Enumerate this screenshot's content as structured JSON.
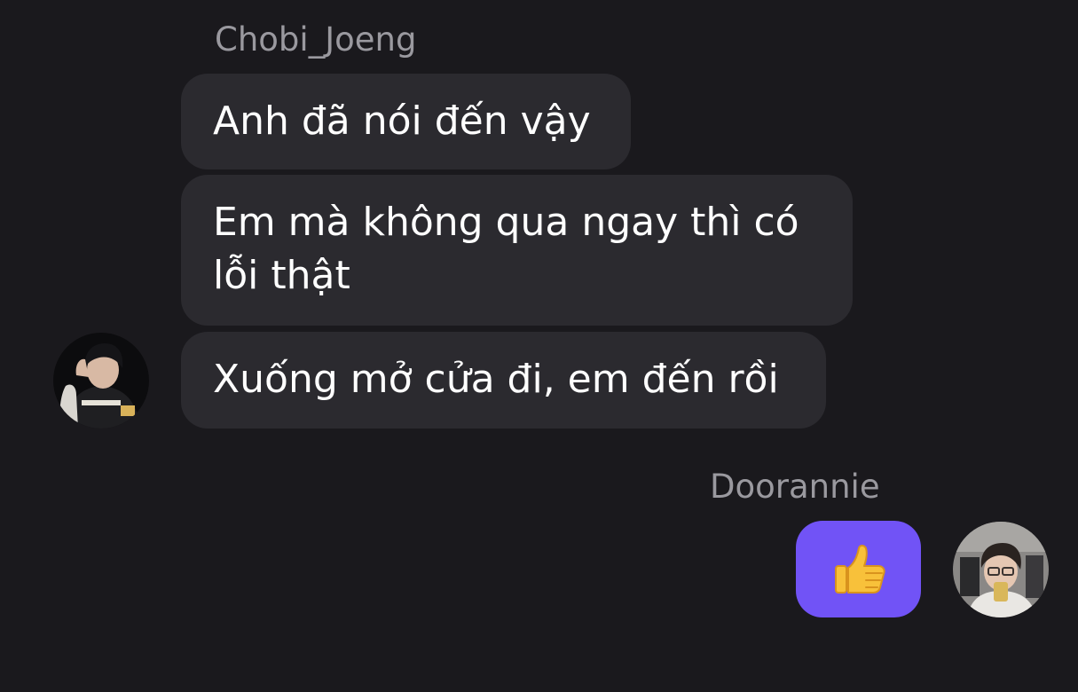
{
  "thread": {
    "incoming": {
      "sender": "Chobi_Joeng",
      "messages": [
        "Anh đã nói đến vậy",
        "Em mà không qua ngay thì có lỗi thật",
        "Xuống mở cửa đi, em đến rồi"
      ],
      "avatar_icon": "user-photo-avatar"
    },
    "outgoing": {
      "sender": "Doorannie",
      "reaction_icon": "thumbs-up-icon",
      "avatar_icon": "user-photo-avatar"
    }
  },
  "colors": {
    "background": "#1a191d",
    "incoming_bubble": "#2b2a2f",
    "outgoing_bubble": "#7153f6",
    "sender_name": "#9a999f",
    "message_text": "#ffffff"
  }
}
